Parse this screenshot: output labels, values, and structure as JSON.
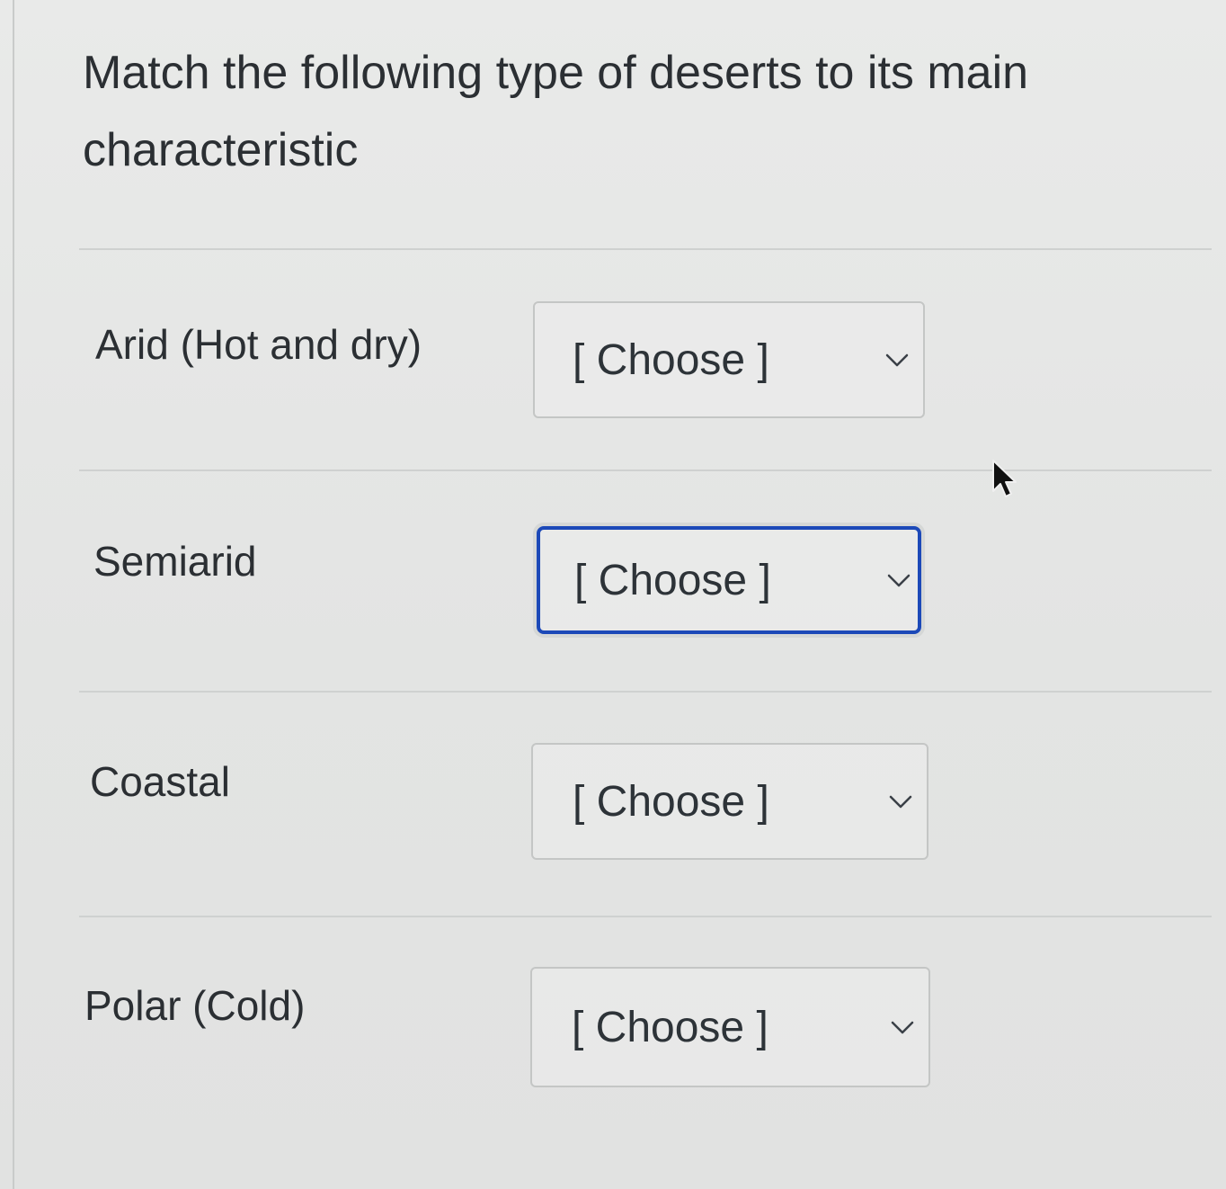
{
  "question": {
    "text": "Match the following type of deserts to its main characteristic"
  },
  "rows": [
    {
      "label": "Arid (Hot and dry)",
      "selected": "[ Choose ]",
      "focused": false
    },
    {
      "label": "Semiarid",
      "selected": "[ Choose ]",
      "focused": true
    },
    {
      "label": "Coastal",
      "selected": "[ Choose ]",
      "focused": false
    },
    {
      "label": "Polar (Cold)",
      "selected": "[ Choose ]",
      "focused": false
    }
  ],
  "icons": {
    "dropdown": "chevron-down-icon",
    "cursor": "mouse-pointer-icon"
  },
  "colors": {
    "focus_border": "#1c49b8",
    "text": "#2b2f33",
    "border": "#c4c6c5"
  }
}
